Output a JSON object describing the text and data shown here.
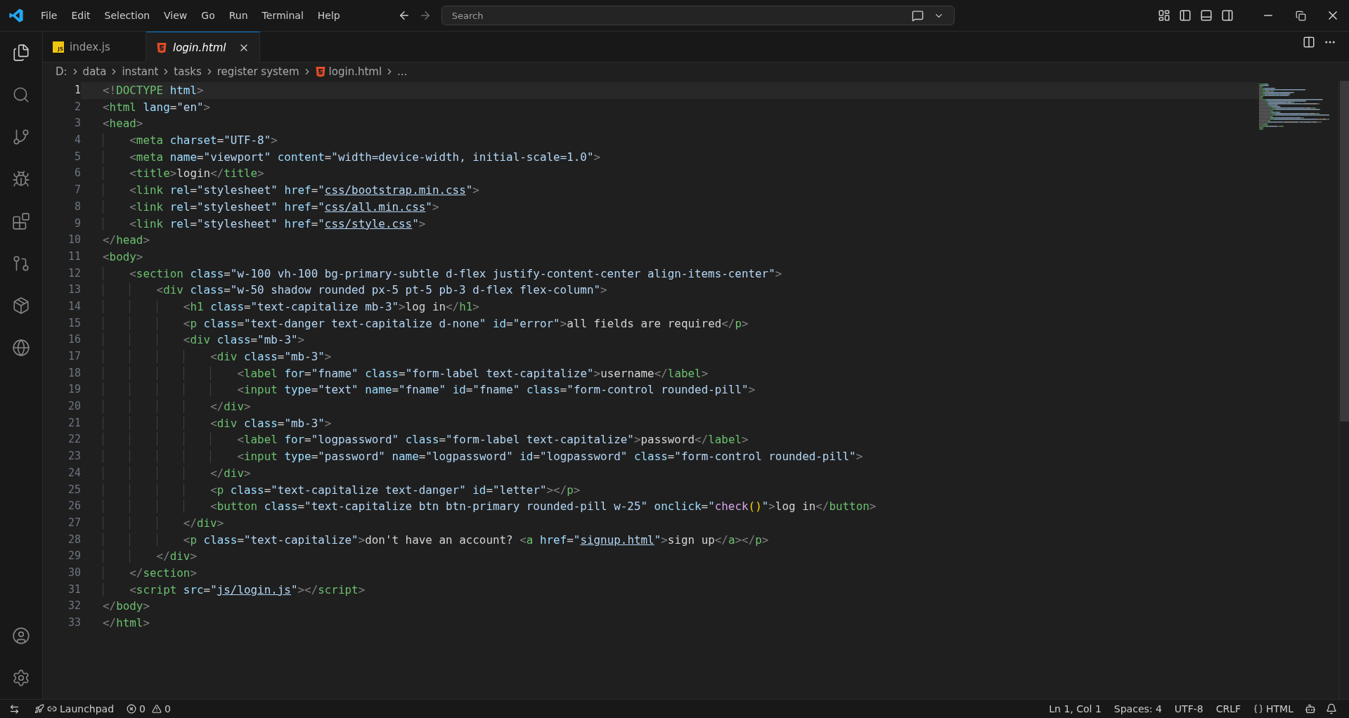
{
  "menu": [
    "File",
    "Edit",
    "Selection",
    "View",
    "Go",
    "Run",
    "Terminal",
    "Help"
  ],
  "search": {
    "placeholder": "Search"
  },
  "tabs": [
    {
      "label": "index.js",
      "kind": "js",
      "badge": "JS",
      "selected": false
    },
    {
      "label": "login.html",
      "kind": "html",
      "selected": true
    }
  ],
  "breadcrumbs": [
    {
      "label": "D:",
      "kind": "folder"
    },
    {
      "label": "data",
      "kind": "folder"
    },
    {
      "label": "instant",
      "kind": "folder"
    },
    {
      "label": "tasks",
      "kind": "folder"
    },
    {
      "label": "register system",
      "kind": "folder"
    },
    {
      "label": "login.html",
      "kind": "html"
    },
    {
      "label": "...",
      "kind": "more"
    }
  ],
  "editor": {
    "lines": [
      {
        "number": "1",
        "selected": true,
        "tokens": [
          {
            "kind": "pu",
            "text": "<!"
          },
          {
            "kind": "tg",
            "text": "DOCTYPE"
          },
          {
            "kind": "at",
            "text": " html"
          },
          {
            "kind": "pu",
            "text": ">"
          }
        ]
      },
      {
        "number": "2",
        "selected": false,
        "tokens": [
          {
            "kind": "pu",
            "text": "<"
          },
          {
            "kind": "tg",
            "text": "html"
          },
          {
            "kind": "at",
            "text": " lang"
          },
          {
            "kind": "tx",
            "text": "="
          },
          {
            "kind": "st",
            "text": "\"en\""
          },
          {
            "kind": "pu",
            "text": ">"
          }
        ]
      },
      {
        "number": "3",
        "selected": false,
        "tokens": [
          {
            "kind": "pu",
            "text": "<"
          },
          {
            "kind": "tg",
            "text": "head"
          },
          {
            "kind": "pu",
            "text": ">"
          }
        ]
      },
      {
        "number": "4",
        "selected": false,
        "tokens": [
          {
            "kind": "pu",
            "text": "    <"
          },
          {
            "kind": "tg",
            "text": "meta"
          },
          {
            "kind": "at",
            "text": " charset"
          },
          {
            "kind": "tx",
            "text": "="
          },
          {
            "kind": "st",
            "text": "\"UTF-8\""
          },
          {
            "kind": "pu",
            "text": ">"
          }
        ]
      },
      {
        "number": "5",
        "selected": false,
        "tokens": [
          {
            "kind": "pu",
            "text": "    <"
          },
          {
            "kind": "tg",
            "text": "meta"
          },
          {
            "kind": "at",
            "text": " name"
          },
          {
            "kind": "tx",
            "text": "="
          },
          {
            "kind": "st",
            "text": "\"viewport\""
          },
          {
            "kind": "at",
            "text": " content"
          },
          {
            "kind": "tx",
            "text": "="
          },
          {
            "kind": "st",
            "text": "\"width=device-width, initial-scale=1.0\""
          },
          {
            "kind": "pu",
            "text": ">"
          }
        ]
      },
      {
        "number": "6",
        "selected": false,
        "tokens": [
          {
            "kind": "pu",
            "text": "    <"
          },
          {
            "kind": "tg",
            "text": "title"
          },
          {
            "kind": "pu",
            "text": ">"
          },
          {
            "kind": "tx",
            "text": "login"
          },
          {
            "kind": "pu",
            "text": "</"
          },
          {
            "kind": "tg",
            "text": "title"
          },
          {
            "kind": "pu",
            "text": ">"
          }
        ]
      },
      {
        "number": "7",
        "selected": false,
        "tokens": [
          {
            "kind": "pu",
            "text": "    <"
          },
          {
            "kind": "tg",
            "text": "link"
          },
          {
            "kind": "at",
            "text": " rel"
          },
          {
            "kind": "tx",
            "text": "="
          },
          {
            "kind": "st",
            "text": "\"stylesheet\""
          },
          {
            "kind": "at",
            "text": " href"
          },
          {
            "kind": "tx",
            "text": "="
          },
          {
            "kind": "st",
            "text": "\""
          },
          {
            "kind": "ln",
            "text": "css/bootstrap.min.css"
          },
          {
            "kind": "st",
            "text": "\""
          },
          {
            "kind": "pu",
            "text": ">"
          }
        ]
      },
      {
        "number": "8",
        "selected": false,
        "tokens": [
          {
            "kind": "pu",
            "text": "    <"
          },
          {
            "kind": "tg",
            "text": "link"
          },
          {
            "kind": "at",
            "text": " rel"
          },
          {
            "kind": "tx",
            "text": "="
          },
          {
            "kind": "st",
            "text": "\"stylesheet\""
          },
          {
            "kind": "at",
            "text": " href"
          },
          {
            "kind": "tx",
            "text": "="
          },
          {
            "kind": "st",
            "text": "\""
          },
          {
            "kind": "ln",
            "text": "css/all.min.css"
          },
          {
            "kind": "st",
            "text": "\""
          },
          {
            "kind": "pu",
            "text": ">"
          }
        ]
      },
      {
        "number": "9",
        "selected": false,
        "tokens": [
          {
            "kind": "pu",
            "text": "    <"
          },
          {
            "kind": "tg",
            "text": "link"
          },
          {
            "kind": "at",
            "text": " rel"
          },
          {
            "kind": "tx",
            "text": "="
          },
          {
            "kind": "st",
            "text": "\"stylesheet\""
          },
          {
            "kind": "at",
            "text": " href"
          },
          {
            "kind": "tx",
            "text": "="
          },
          {
            "kind": "st",
            "text": "\""
          },
          {
            "kind": "ln",
            "text": "css/style.css"
          },
          {
            "kind": "st",
            "text": "\""
          },
          {
            "kind": "pu",
            "text": ">"
          }
        ]
      },
      {
        "number": "10",
        "selected": false,
        "tokens": [
          {
            "kind": "pu",
            "text": "</"
          },
          {
            "kind": "tg",
            "text": "head"
          },
          {
            "kind": "pu",
            "text": ">"
          }
        ]
      },
      {
        "number": "11",
        "selected": false,
        "tokens": [
          {
            "kind": "pu",
            "text": "<"
          },
          {
            "kind": "tg",
            "text": "body"
          },
          {
            "kind": "pu",
            "text": ">"
          }
        ]
      },
      {
        "number": "12",
        "selected": false,
        "tokens": [
          {
            "kind": "pu",
            "text": "    <"
          },
          {
            "kind": "tg",
            "text": "section"
          },
          {
            "kind": "at",
            "text": " class"
          },
          {
            "kind": "tx",
            "text": "="
          },
          {
            "kind": "st",
            "text": "\"w-100 vh-100 bg-primary-subtle d-flex justify-content-center align-items-center\""
          },
          {
            "kind": "pu",
            "text": ">"
          }
        ]
      },
      {
        "number": "13",
        "selected": false,
        "tokens": [
          {
            "kind": "pu",
            "text": "        <"
          },
          {
            "kind": "tg",
            "text": "div"
          },
          {
            "kind": "at",
            "text": " class"
          },
          {
            "kind": "tx",
            "text": "="
          },
          {
            "kind": "st",
            "text": "\"w-50 shadow rounded px-5 pt-5 pb-3 d-flex flex-column\""
          },
          {
            "kind": "pu",
            "text": ">"
          }
        ]
      },
      {
        "number": "14",
        "selected": false,
        "tokens": [
          {
            "kind": "pu",
            "text": "            <"
          },
          {
            "kind": "tg",
            "text": "h1"
          },
          {
            "kind": "at",
            "text": " class"
          },
          {
            "kind": "tx",
            "text": "="
          },
          {
            "kind": "st",
            "text": "\"text-capitalize mb-3\""
          },
          {
            "kind": "pu",
            "text": ">"
          },
          {
            "kind": "tx",
            "text": "log in"
          },
          {
            "kind": "pu",
            "text": "</"
          },
          {
            "kind": "tg",
            "text": "h1"
          },
          {
            "kind": "pu",
            "text": ">"
          }
        ]
      },
      {
        "number": "15",
        "selected": false,
        "tokens": [
          {
            "kind": "pu",
            "text": "            <"
          },
          {
            "kind": "tg",
            "text": "p"
          },
          {
            "kind": "at",
            "text": " class"
          },
          {
            "kind": "tx",
            "text": "="
          },
          {
            "kind": "st",
            "text": "\"text-danger text-capitalize d-none\""
          },
          {
            "kind": "at",
            "text": " id"
          },
          {
            "kind": "tx",
            "text": "="
          },
          {
            "kind": "st",
            "text": "\"error\""
          },
          {
            "kind": "pu",
            "text": ">"
          },
          {
            "kind": "tx",
            "text": "all fields are required"
          },
          {
            "kind": "pu",
            "text": "</"
          },
          {
            "kind": "tg",
            "text": "p"
          },
          {
            "kind": "pu",
            "text": ">"
          }
        ]
      },
      {
        "number": "16",
        "selected": false,
        "tokens": [
          {
            "kind": "pu",
            "text": "            <"
          },
          {
            "kind": "tg",
            "text": "div"
          },
          {
            "kind": "at",
            "text": " class"
          },
          {
            "kind": "tx",
            "text": "="
          },
          {
            "kind": "st",
            "text": "\"mb-3\""
          },
          {
            "kind": "pu",
            "text": ">"
          }
        ]
      },
      {
        "number": "17",
        "selected": false,
        "tokens": [
          {
            "kind": "pu",
            "text": "                <"
          },
          {
            "kind": "tg",
            "text": "div"
          },
          {
            "kind": "at",
            "text": " class"
          },
          {
            "kind": "tx",
            "text": "="
          },
          {
            "kind": "st",
            "text": "\"mb-3\""
          },
          {
            "kind": "pu",
            "text": ">"
          }
        ]
      },
      {
        "number": "18",
        "selected": false,
        "tokens": [
          {
            "kind": "pu",
            "text": "                    <"
          },
          {
            "kind": "tg",
            "text": "label"
          },
          {
            "kind": "at",
            "text": " for"
          },
          {
            "kind": "tx",
            "text": "="
          },
          {
            "kind": "st",
            "text": "\"fname\""
          },
          {
            "kind": "at",
            "text": " class"
          },
          {
            "kind": "tx",
            "text": "="
          },
          {
            "kind": "st",
            "text": "\"form-label text-capitalize\""
          },
          {
            "kind": "pu",
            "text": ">"
          },
          {
            "kind": "tx",
            "text": "username"
          },
          {
            "kind": "pu",
            "text": "</"
          },
          {
            "kind": "tg",
            "text": "label"
          },
          {
            "kind": "pu",
            "text": ">"
          }
        ]
      },
      {
        "number": "19",
        "selected": false,
        "tokens": [
          {
            "kind": "pu",
            "text": "                    <"
          },
          {
            "kind": "tg",
            "text": "input"
          },
          {
            "kind": "at",
            "text": " type"
          },
          {
            "kind": "tx",
            "text": "="
          },
          {
            "kind": "st",
            "text": "\"text\""
          },
          {
            "kind": "at",
            "text": " name"
          },
          {
            "kind": "tx",
            "text": "="
          },
          {
            "kind": "st",
            "text": "\"fname\""
          },
          {
            "kind": "at",
            "text": " id"
          },
          {
            "kind": "tx",
            "text": "="
          },
          {
            "kind": "st",
            "text": "\"fname\""
          },
          {
            "kind": "at",
            "text": " class"
          },
          {
            "kind": "tx",
            "text": "="
          },
          {
            "kind": "st",
            "text": "\"form-control rounded-pill\""
          },
          {
            "kind": "pu",
            "text": ">"
          }
        ]
      },
      {
        "number": "20",
        "selected": false,
        "tokens": [
          {
            "kind": "pu",
            "text": "                </"
          },
          {
            "kind": "tg",
            "text": "div"
          },
          {
            "kind": "pu",
            "text": ">"
          }
        ]
      },
      {
        "number": "21",
        "selected": false,
        "tokens": [
          {
            "kind": "pu",
            "text": "                <"
          },
          {
            "kind": "tg",
            "text": "div"
          },
          {
            "kind": "at",
            "text": " class"
          },
          {
            "kind": "tx",
            "text": "="
          },
          {
            "kind": "st",
            "text": "\"mb-3\""
          },
          {
            "kind": "pu",
            "text": ">"
          }
        ]
      },
      {
        "number": "22",
        "selected": false,
        "tokens": [
          {
            "kind": "pu",
            "text": "                    <"
          },
          {
            "kind": "tg",
            "text": "label"
          },
          {
            "kind": "at",
            "text": " for"
          },
          {
            "kind": "tx",
            "text": "="
          },
          {
            "kind": "st",
            "text": "\"logpassword\""
          },
          {
            "kind": "at",
            "text": " class"
          },
          {
            "kind": "tx",
            "text": "="
          },
          {
            "kind": "st",
            "text": "\"form-label text-capitalize\""
          },
          {
            "kind": "pu",
            "text": ">"
          },
          {
            "kind": "tx",
            "text": "password"
          },
          {
            "kind": "pu",
            "text": "</"
          },
          {
            "kind": "tg",
            "text": "label"
          },
          {
            "kind": "pu",
            "text": ">"
          }
        ]
      },
      {
        "number": "23",
        "selected": false,
        "tokens": [
          {
            "kind": "pu",
            "text": "                    <"
          },
          {
            "kind": "tg",
            "text": "input"
          },
          {
            "kind": "at",
            "text": " type"
          },
          {
            "kind": "tx",
            "text": "="
          },
          {
            "kind": "st",
            "text": "\"password\""
          },
          {
            "kind": "at",
            "text": " name"
          },
          {
            "kind": "tx",
            "text": "="
          },
          {
            "kind": "st",
            "text": "\"logpassword\""
          },
          {
            "kind": "at",
            "text": " id"
          },
          {
            "kind": "tx",
            "text": "="
          },
          {
            "kind": "st",
            "text": "\"logpassword\""
          },
          {
            "kind": "at",
            "text": " class"
          },
          {
            "kind": "tx",
            "text": "="
          },
          {
            "kind": "st",
            "text": "\"form-control rounded-pill\""
          },
          {
            "kind": "pu",
            "text": ">"
          }
        ]
      },
      {
        "number": "24",
        "selected": false,
        "tokens": [
          {
            "kind": "pu",
            "text": "                </"
          },
          {
            "kind": "tg",
            "text": "div"
          },
          {
            "kind": "pu",
            "text": ">"
          }
        ]
      },
      {
        "number": "25",
        "selected": false,
        "tokens": [
          {
            "kind": "pu",
            "text": "                <"
          },
          {
            "kind": "tg",
            "text": "p"
          },
          {
            "kind": "at",
            "text": " class"
          },
          {
            "kind": "tx",
            "text": "="
          },
          {
            "kind": "st",
            "text": "\"text-capitalize text-danger\""
          },
          {
            "kind": "at",
            "text": " id"
          },
          {
            "kind": "tx",
            "text": "="
          },
          {
            "kind": "st",
            "text": "\"letter\""
          },
          {
            "kind": "pu",
            "text": "></"
          },
          {
            "kind": "tg",
            "text": "p"
          },
          {
            "kind": "pu",
            "text": ">"
          }
        ]
      },
      {
        "number": "26",
        "selected": false,
        "tokens": [
          {
            "kind": "pu",
            "text": "                <"
          },
          {
            "kind": "tg",
            "text": "button"
          },
          {
            "kind": "at",
            "text": " class"
          },
          {
            "kind": "tx",
            "text": "="
          },
          {
            "kind": "st",
            "text": "\"text-capitalize btn btn-primary rounded-pill w-25\""
          },
          {
            "kind": "at",
            "text": " onclick"
          },
          {
            "kind": "tx",
            "text": "="
          },
          {
            "kind": "st",
            "text": "\""
          },
          {
            "kind": "fn",
            "text": "check"
          },
          {
            "kind": "br",
            "text": "()"
          },
          {
            "kind": "st",
            "text": "\""
          },
          {
            "kind": "pu",
            "text": ">"
          },
          {
            "kind": "tx",
            "text": "log in"
          },
          {
            "kind": "pu",
            "text": "</"
          },
          {
            "kind": "tg",
            "text": "button"
          },
          {
            "kind": "pu",
            "text": ">"
          }
        ]
      },
      {
        "number": "27",
        "selected": false,
        "tokens": [
          {
            "kind": "pu",
            "text": "            </"
          },
          {
            "kind": "tg",
            "text": "div"
          },
          {
            "kind": "pu",
            "text": ">"
          }
        ]
      },
      {
        "number": "28",
        "selected": false,
        "tokens": [
          {
            "kind": "pu",
            "text": "            <"
          },
          {
            "kind": "tg",
            "text": "p"
          },
          {
            "kind": "at",
            "text": " class"
          },
          {
            "kind": "tx",
            "text": "="
          },
          {
            "kind": "st",
            "text": "\"text-capitalize\""
          },
          {
            "kind": "pu",
            "text": ">"
          },
          {
            "kind": "tx",
            "text": "don't have an account? "
          },
          {
            "kind": "pu",
            "text": "<"
          },
          {
            "kind": "tg",
            "text": "a"
          },
          {
            "kind": "at",
            "text": " href"
          },
          {
            "kind": "tx",
            "text": "="
          },
          {
            "kind": "st",
            "text": "\""
          },
          {
            "kind": "ln",
            "text": "signup.html"
          },
          {
            "kind": "st",
            "text": "\""
          },
          {
            "kind": "pu",
            "text": ">"
          },
          {
            "kind": "tx",
            "text": "sign up"
          },
          {
            "kind": "pu",
            "text": "</"
          },
          {
            "kind": "tg",
            "text": "a"
          },
          {
            "kind": "pu",
            "text": "></"
          },
          {
            "kind": "tg",
            "text": "p"
          },
          {
            "kind": "pu",
            "text": ">"
          }
        ]
      },
      {
        "number": "29",
        "selected": false,
        "tokens": [
          {
            "kind": "pu",
            "text": "        </"
          },
          {
            "kind": "tg",
            "text": "div"
          },
          {
            "kind": "pu",
            "text": ">"
          }
        ]
      },
      {
        "number": "30",
        "selected": false,
        "tokens": [
          {
            "kind": "pu",
            "text": "    </"
          },
          {
            "kind": "tg",
            "text": "section"
          },
          {
            "kind": "pu",
            "text": ">"
          }
        ]
      },
      {
        "number": "31",
        "selected": false,
        "tokens": [
          {
            "kind": "pu",
            "text": "    <"
          },
          {
            "kind": "tg",
            "text": "script"
          },
          {
            "kind": "at",
            "text": " src"
          },
          {
            "kind": "tx",
            "text": "="
          },
          {
            "kind": "st",
            "text": "\""
          },
          {
            "kind": "ln",
            "text": "js/login.js"
          },
          {
            "kind": "st",
            "text": "\""
          },
          {
            "kind": "pu",
            "text": "></"
          },
          {
            "kind": "tg",
            "text": "script"
          },
          {
            "kind": "pu",
            "text": ">"
          }
        ]
      },
      {
        "number": "32",
        "selected": false,
        "tokens": [
          {
            "kind": "pu",
            "text": "</"
          },
          {
            "kind": "tg",
            "text": "body"
          },
          {
            "kind": "pu",
            "text": ">"
          }
        ]
      },
      {
        "number": "33",
        "selected": false,
        "tokens": [
          {
            "kind": "pu",
            "text": "</"
          },
          {
            "kind": "tg",
            "text": "html"
          },
          {
            "kind": "pu",
            "text": ">"
          }
        ]
      }
    ]
  },
  "status_bar": {
    "left": [
      {
        "kind": "launchpad",
        "label": "Launchpad"
      },
      {
        "kind": "errors",
        "label": "0"
      },
      {
        "kind": "warnings",
        "label": "0"
      }
    ],
    "right": [
      {
        "kind": "text",
        "label": "Ln 1, Col 1"
      },
      {
        "kind": "text",
        "label": "Spaces: 4"
      },
      {
        "kind": "text",
        "label": "UTF-8"
      },
      {
        "kind": "text",
        "label": "CRLF"
      },
      {
        "kind": "language",
        "label": "HTML"
      }
    ]
  }
}
